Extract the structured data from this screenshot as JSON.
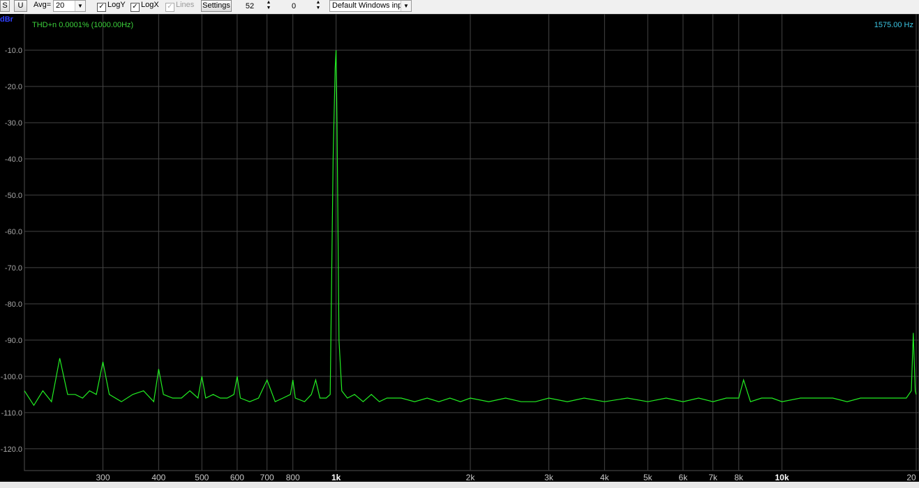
{
  "toolbar": {
    "s_label": "S",
    "u_label": "U",
    "avg_label": "Avg=",
    "avg_value": "20",
    "logy_label": "LogY",
    "logx_label": "LogX",
    "lines_label": "Lines",
    "settings_label": "Settings",
    "spin1_value": "52",
    "spin2_value": "0",
    "device_value": "Default Windows inp"
  },
  "plot": {
    "unit_label": "dBr",
    "thd_text": "THD+n 0.0001% (1000.00Hz)",
    "cursor_freq_text": "1575.00 Hz"
  },
  "colors": {
    "trace": "#22ee22",
    "background": "#000000",
    "grid": "#444444",
    "thd_text": "#3cd23c",
    "freq_text": "#3cc8e6"
  },
  "chart_data": {
    "type": "line",
    "title": "",
    "xlabel": "",
    "ylabel": "dBr",
    "x_scale": "log",
    "xlim": [
      200,
      20000
    ],
    "ylim": [
      -126,
      0
    ],
    "grid": true,
    "y_ticks": [
      -10,
      -20,
      -30,
      -40,
      -50,
      -60,
      -70,
      -80,
      -90,
      -100,
      -110,
      -120
    ],
    "y_tick_labels": [
      "-10.0",
      "-20.0",
      "-30.0",
      "-40.0",
      "-50.0",
      "-60.0",
      "-70.0",
      "-80.0",
      "-90.0",
      "-100.0",
      "-110.0",
      "-120.0"
    ],
    "x_ticks": [
      300,
      400,
      500,
      600,
      700,
      800,
      1000,
      2000,
      3000,
      4000,
      5000,
      6000,
      7000,
      8000,
      10000,
      20000
    ],
    "x_tick_labels": [
      "300",
      "400",
      "500",
      "600",
      "700",
      "800",
      "1k",
      "2k",
      "3k",
      "4k",
      "5k",
      "6k",
      "7k",
      "8k",
      "10k",
      "20"
    ],
    "series": [
      {
        "name": "",
        "x": [
          200,
          210,
          220,
          230,
          240,
          250,
          260,
          270,
          280,
          290,
          300,
          310,
          330,
          350,
          370,
          390,
          400,
          410,
          430,
          450,
          470,
          490,
          500,
          510,
          530,
          550,
          570,
          590,
          600,
          610,
          640,
          670,
          700,
          730,
          760,
          790,
          800,
          810,
          850,
          880,
          900,
          920,
          950,
          970,
          985,
          995,
          1000,
          1005,
          1015,
          1030,
          1060,
          1100,
          1150,
          1200,
          1250,
          1300,
          1400,
          1500,
          1600,
          1700,
          1800,
          1900,
          2000,
          2200,
          2400,
          2600,
          2800,
          3000,
          3300,
          3600,
          4000,
          4500,
          5000,
          5500,
          6000,
          6500,
          7000,
          7500,
          8000,
          8200,
          8500,
          9000,
          9500,
          10000,
          11000,
          12000,
          13000,
          14000,
          15000,
          16000,
          17000,
          18000,
          19000,
          19500,
          19700,
          19900,
          20000
        ],
        "values": [
          -104,
          -108,
          -104,
          -107,
          -95,
          -105,
          -105,
          -106,
          -104,
          -105,
          -96,
          -105,
          -107,
          -105,
          -104,
          -107,
          -98,
          -105,
          -106,
          -106,
          -104,
          -106,
          -100,
          -106,
          -105,
          -106,
          -106,
          -105,
          -100,
          -106,
          -107,
          -106,
          -101,
          -107,
          -106,
          -105,
          -101,
          -106,
          -107,
          -105,
          -101,
          -106,
          -106,
          -105,
          -40,
          -15,
          -10,
          -30,
          -90,
          -104,
          -106,
          -105,
          -107,
          -105,
          -107,
          -106,
          -106,
          -107,
          -106,
          -107,
          -106,
          -107,
          -106,
          -107,
          -106,
          -107,
          -107,
          -106,
          -107,
          -106,
          -107,
          -106,
          -107,
          -106,
          -107,
          -106,
          -107,
          -106,
          -106,
          -101,
          -107,
          -106,
          -106,
          -107,
          -106,
          -106,
          -106,
          -107,
          -106,
          -106,
          -106,
          -106,
          -106,
          -104,
          -88,
          -104,
          -105
        ]
      }
    ]
  }
}
